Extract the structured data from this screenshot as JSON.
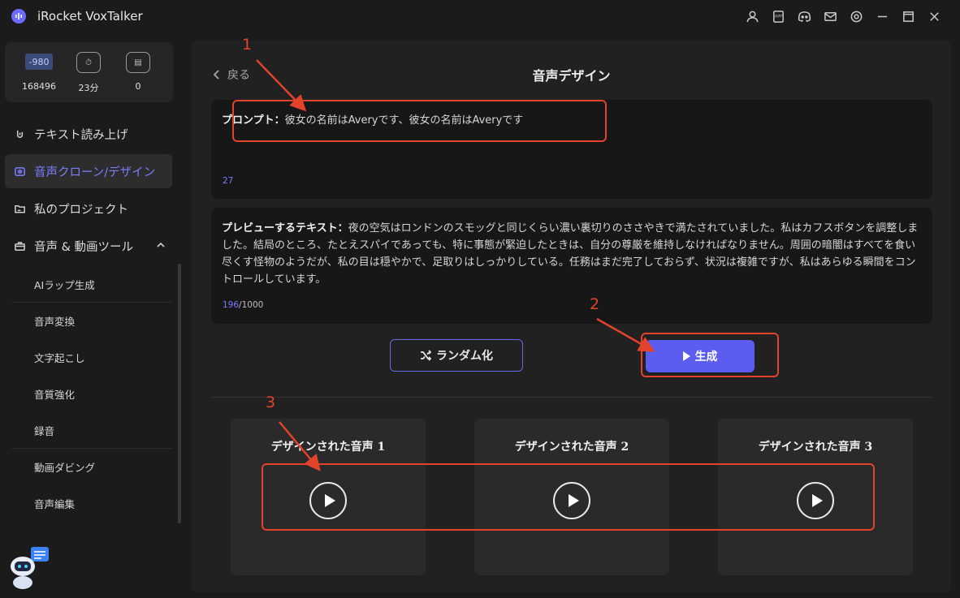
{
  "app": {
    "title": "iRocket VoxTalker"
  },
  "titlebar_icons": [
    "user-icon",
    "app-icon",
    "discord-icon",
    "mail-icon",
    "settings-icon",
    "minimize-icon",
    "maximize-icon",
    "close-icon"
  ],
  "stats": [
    {
      "icon": "credits-icon",
      "badge": "-980",
      "value": "168496"
    },
    {
      "icon": "clock-icon",
      "badge": "",
      "value": "23分"
    },
    {
      "icon": "files-icon",
      "badge": "",
      "value": "0"
    }
  ],
  "sidebar": {
    "items": [
      {
        "label": "テキスト読み上げ",
        "icon": "tts-icon"
      },
      {
        "label": "音声クローン/デザイン",
        "icon": "voice-clone-icon"
      },
      {
        "label": "私のプロジェクト",
        "icon": "folder-icon"
      },
      {
        "label": "音声 & 動画ツール",
        "icon": "toolbox-icon"
      }
    ],
    "subitems": [
      {
        "label": "AIラップ生成"
      },
      {
        "label": "音声変換"
      },
      {
        "label": "文字起こし"
      },
      {
        "label": "音質強化"
      },
      {
        "label": "録音"
      },
      {
        "label": "動画ダビング"
      },
      {
        "label": "音声編集"
      }
    ]
  },
  "main": {
    "back_label": "戻る",
    "page_title": "音声デザイン",
    "prompt": {
      "label": "プロンプト：",
      "text": "彼女の名前はAveryです、彼女の名前はAveryです",
      "count": "27"
    },
    "preview": {
      "label": "プレビューするテキスト：",
      "text": "夜の空気はロンドンのスモッグと同じくらい濃い裏切りのささやきで満たされていました。私はカフスボタンを調整しました。結局のところ、たとえスパイであっても、特に事態が緊迫したときは、自分の尊厳を維持しなければなりません。周囲の暗闇はすべてを食い尽くす怪物のようだが、私の目は穏やかで、足取りはしっかりしている。任務はまだ完了しておらず、状況は複雑ですが、私はあらゆる瞬間をコントロールしています。",
      "count_current": "196",
      "count_max": "/1000"
    },
    "randomize_label": "ランダム化",
    "generate_label": "生成",
    "voices": [
      {
        "title": "デザインされた音声 1"
      },
      {
        "title": "デザインされた音声 2"
      },
      {
        "title": "デザインされた音声 3"
      }
    ]
  },
  "annotations": [
    "1",
    "2",
    "3"
  ],
  "colors": {
    "accent": "#5b5cf0",
    "annotation": "#e2432c",
    "active_nav": "#7b7dff"
  }
}
